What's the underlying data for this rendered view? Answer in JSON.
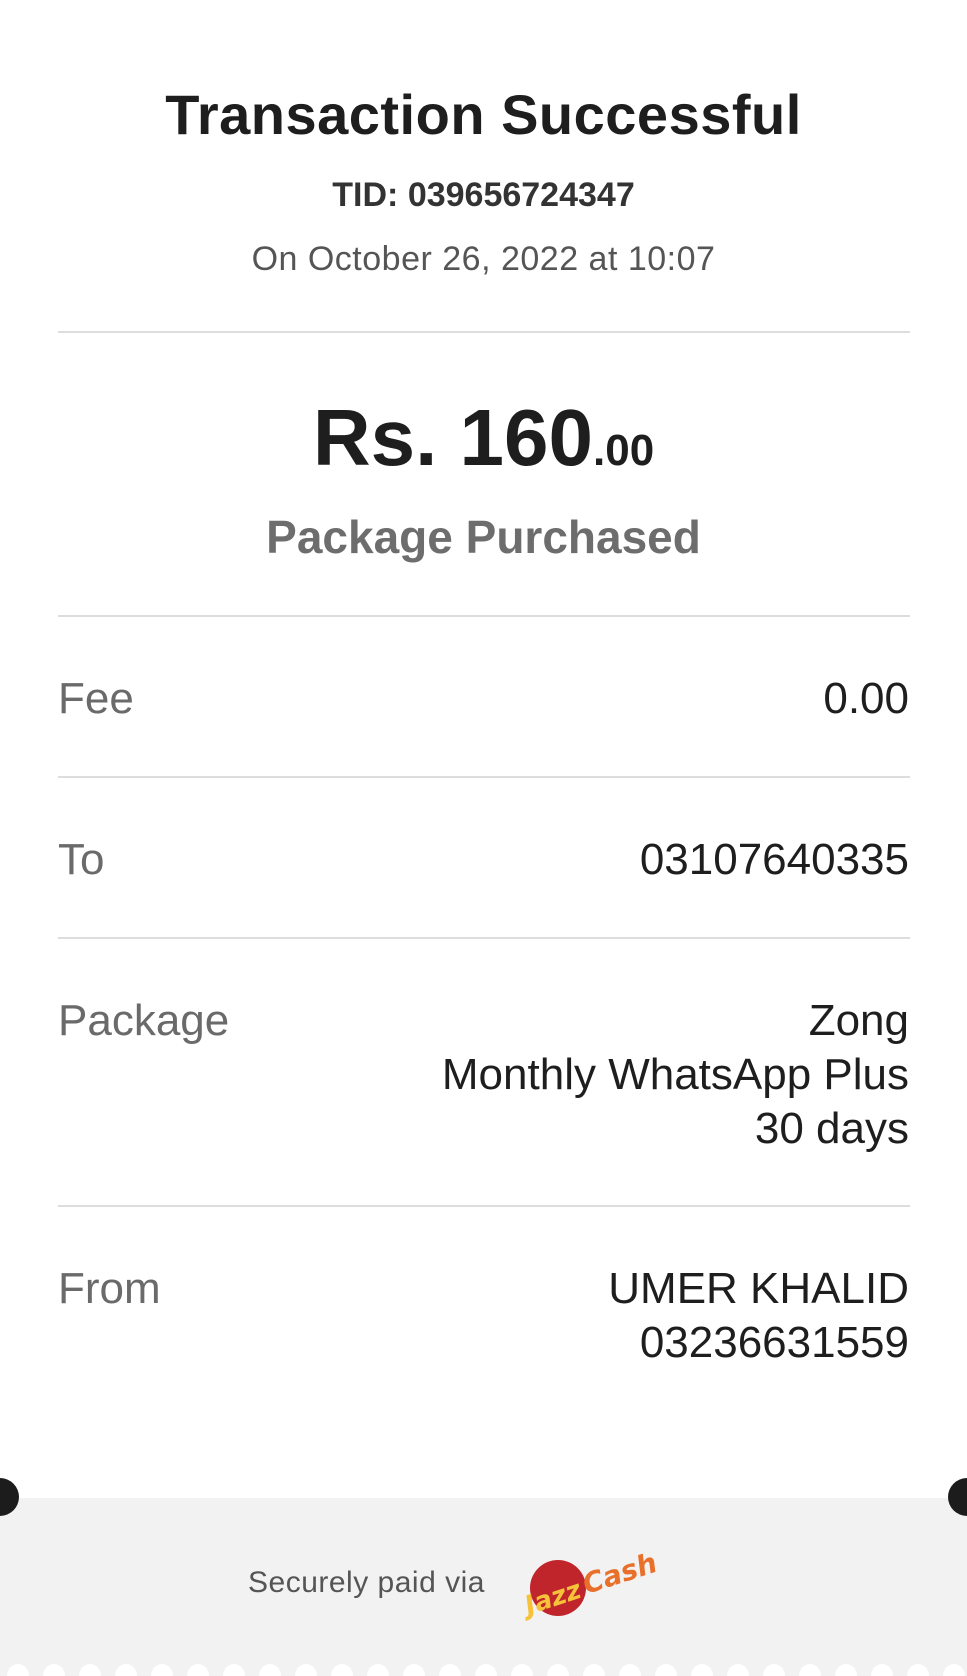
{
  "header": {
    "title": "Transaction Successful",
    "tid_label": "TID:",
    "tid_value": "039656724347",
    "datetime": "On October 26, 2022 at 10:07"
  },
  "amount": {
    "main": "Rs. 160",
    "decimal": ".00",
    "label": "Package Purchased"
  },
  "details": {
    "fee": {
      "label": "Fee",
      "value": "0.00"
    },
    "to": {
      "label": "To",
      "value": "03107640335"
    },
    "package": {
      "label": "Package",
      "lines": [
        "Zong",
        "Monthly WhatsApp Plus",
        "30 days"
      ]
    },
    "from": {
      "label": "From",
      "name": "UMER KHALID",
      "number": "03236631559"
    }
  },
  "footer": {
    "secure_text": "Securely paid via",
    "logo_text": [
      "Jazz",
      "Cash"
    ],
    "colors": {
      "logo_red": "#c0252b",
      "logo_yellow": "#f6c23a",
      "logo_orange": "#e8702a"
    }
  }
}
